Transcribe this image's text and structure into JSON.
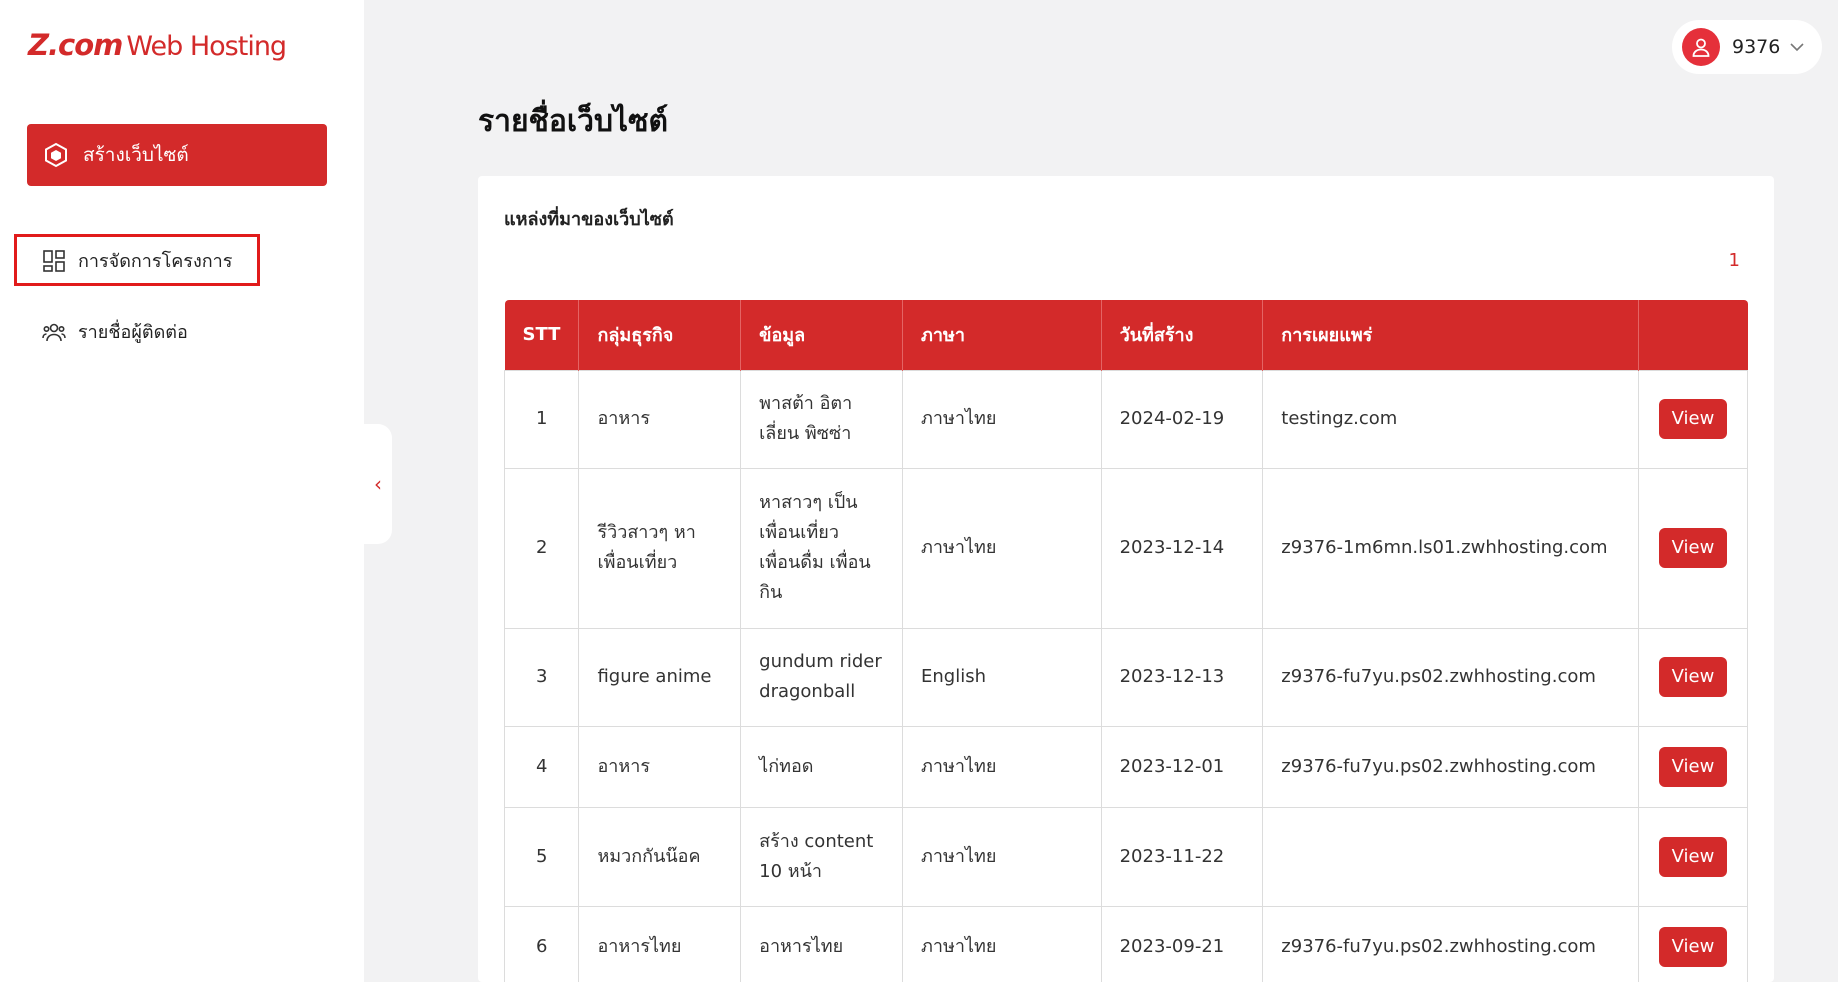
{
  "brand": {
    "logo_z": "Z.com",
    "logo_rest": "Web Hosting",
    "accent_color": "#d32a2a"
  },
  "sidebar": {
    "create_button_label": "สร้างเว็บไซต์",
    "items": [
      {
        "label": "การจัดการโครงการ",
        "icon": "grid-icon",
        "highlighted": true
      },
      {
        "label": "รายชื่อผู้ติดต่อ",
        "icon": "users-icon"
      }
    ],
    "collapse_glyph": "‹"
  },
  "user": {
    "name": "9376",
    "avatar_icon": "user-icon"
  },
  "page": {
    "title": "รายชื่อเว็บไซต์",
    "card_title": "แหล่งที่มาของเว็บไซต์",
    "current_page": "1"
  },
  "table": {
    "headers": [
      "STT",
      "กลุ่มธุรกิจ",
      "ข้อมูล",
      "ภาษา",
      "วันที่สร้าง",
      "การเผยแพร่",
      ""
    ],
    "action_label": "View",
    "rows": [
      {
        "stt": "1",
        "group": "อาหาร",
        "info": "พาสต้า อิตาเลี่ยน พิซซ่า",
        "lang": "ภาษาไทย",
        "date": "2024-02-19",
        "pub": "testingz.com"
      },
      {
        "stt": "2",
        "group": "รีวิวสาวๆ หาเพื่อนเที่ยว",
        "info": "หาสาวๆ เป็นเพื่อนเที่ยว เพื่อนดื่ม เพื่อนกิน",
        "lang": "ภาษาไทย",
        "date": "2023-12-14",
        "pub": "z9376-1m6mn.ls01.zwhhosting.com"
      },
      {
        "stt": "3",
        "group": "figure anime",
        "info": "gundum rider dragonball",
        "lang": "English",
        "date": "2023-12-13",
        "pub": "z9376-fu7yu.ps02.zwhhosting.com"
      },
      {
        "stt": "4",
        "group": "อาหาร",
        "info": "ไก่ทอด",
        "lang": "ภาษาไทย",
        "date": "2023-12-01",
        "pub": "z9376-fu7yu.ps02.zwhhosting.com"
      },
      {
        "stt": "5",
        "group": "หมวกกันน๊อค",
        "info": "สร้าง content 10 หน้า",
        "lang": "ภาษาไทย",
        "date": "2023-11-22",
        "pub": ""
      },
      {
        "stt": "6",
        "group": "อาหารไทย",
        "info": "อาหารไทย",
        "lang": "ภาษาไทย",
        "date": "2023-09-21",
        "pub": "z9376-fu7yu.ps02.zwhhosting.com"
      }
    ]
  }
}
